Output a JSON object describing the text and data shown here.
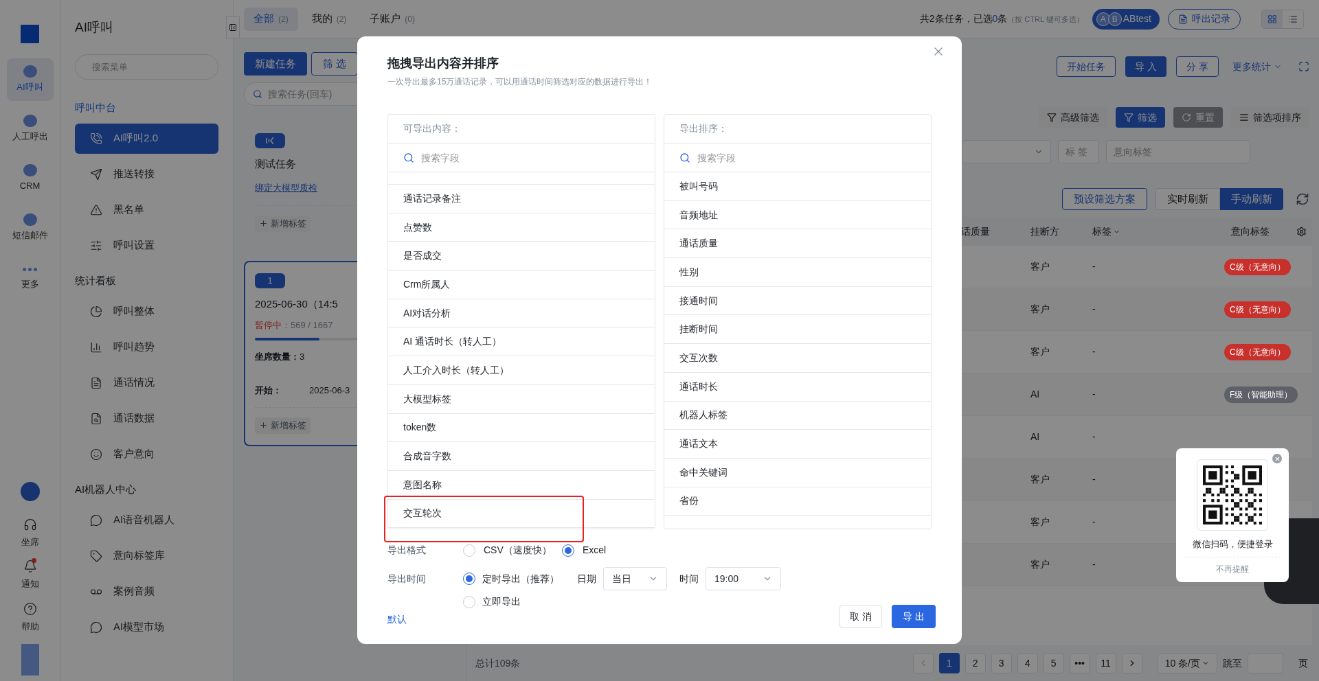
{
  "rail": {
    "items": [
      {
        "label": "AI呼叫",
        "selected": true
      },
      {
        "label": "人工呼出",
        "selected": false
      },
      {
        "label": "CRM",
        "selected": false
      },
      {
        "label": "短信邮件",
        "selected": false
      },
      {
        "label": "更多",
        "selected": false
      }
    ],
    "bottom": [
      {
        "label": "坐席",
        "badge": false
      },
      {
        "label": "通知",
        "badge": true
      },
      {
        "label": "帮助",
        "badge": false
      }
    ]
  },
  "menu": {
    "title": "AI呼叫",
    "search_placeholder": "搜索菜单",
    "sections": [
      {
        "title": "呼叫中台",
        "active": true,
        "items": [
          {
            "label": "AI呼叫2.0",
            "selected": true
          },
          {
            "label": "推送转接",
            "selected": false
          },
          {
            "label": "黑名单",
            "selected": false
          },
          {
            "label": "呼叫设置",
            "selected": false
          }
        ]
      },
      {
        "title": "统计看板",
        "active": false,
        "items": [
          {
            "label": "呼叫整体",
            "selected": false
          },
          {
            "label": "呼叫趋势",
            "selected": false
          },
          {
            "label": "通话情况",
            "selected": false
          },
          {
            "label": "通话数据",
            "selected": false
          },
          {
            "label": "客户意向",
            "selected": false
          }
        ]
      },
      {
        "title": "AI机器人中心",
        "active": false,
        "items": [
          {
            "label": "AI语音机器人",
            "selected": false
          },
          {
            "label": "意向标签库",
            "selected": false
          },
          {
            "label": "案例音频",
            "selected": false
          },
          {
            "label": "AI模型市场",
            "selected": false
          }
        ]
      }
    ]
  },
  "tabs": [
    {
      "label": "全部",
      "count": "(2)",
      "selected": true
    },
    {
      "label": "我的",
      "count": "(2)",
      "selected": false
    },
    {
      "label": "子账户",
      "count": "(0)",
      "selected": false
    }
  ],
  "summary": {
    "text": "共2条任务，已选",
    "count": "0",
    "suffix": "条",
    "hint": "（按 CTRL 键可多选）"
  },
  "ab_button": {
    "avatars": [
      "A",
      "B"
    ],
    "label": "ABtest"
  },
  "call_log_button": "呼出记录",
  "view_modes": [
    {
      "kind": "grid",
      "selected": true
    },
    {
      "kind": "list",
      "selected": false
    }
  ],
  "task_panel": {
    "buttons": [
      "新建任务",
      "筛 选"
    ],
    "search_placeholder": "搜索任务(回车)",
    "cards": [
      {
        "selected": false,
        "title": "测试任务",
        "link": "绑定大模型质检",
        "add_tag": "新增标签"
      },
      {
        "selected": true,
        "badge": "1",
        "title": "2025-06-30（14:5",
        "status": "暂停中",
        "progress": "：569 / 1667",
        "level": 0.34,
        "seats_label": "坐席数量：",
        "seats": "3",
        "start_label": "开始：",
        "start": "2025-06-3",
        "add_tag": "新增标签"
      }
    ]
  },
  "toolbar": {
    "buttons": [
      "开始任务",
      "导 入",
      "分 享"
    ],
    "more": "更多统计"
  },
  "filter_buttons": [
    {
      "label": "高级筛选",
      "kind": "outline"
    },
    {
      "label": "筛选",
      "kind": "primary"
    },
    {
      "label": "重置",
      "kind": "dark"
    },
    {
      "label": "筛选项排序",
      "kind": "outline"
    }
  ],
  "filter_fields": [
    {
      "placeholder": "标 签"
    },
    {
      "placeholder": "意向标签"
    }
  ],
  "preset_button": "预设筛选方案",
  "refresh_modes": [
    {
      "label": "实时刷新",
      "selected": false
    },
    {
      "label": "手动刷新",
      "selected": true
    }
  ],
  "table": {
    "columns": [
      "话质量",
      "挂断方",
      "标签",
      "意向标签"
    ],
    "rows": [
      {
        "hangup": "客户",
        "tag": "-",
        "intent": "C级（无意向）",
        "color": "#c8302c"
      },
      {
        "hangup": "客户",
        "tag": "-",
        "intent": "C级（无意向）",
        "color": "#c8302c"
      },
      {
        "hangup": "客户",
        "tag": "-",
        "intent": "C级（无意向）",
        "color": "#c8302c"
      },
      {
        "hangup": "AI",
        "tag": "-",
        "intent": "F级（智能助理）",
        "color": "#5d6068"
      },
      {
        "hangup": "AI",
        "tag": "-"
      },
      {
        "hangup": "客户",
        "tag": "-"
      },
      {
        "hangup": "客户",
        "tag": "-"
      },
      {
        "hangup": "客户",
        "tag": "-"
      }
    ]
  },
  "pagination": {
    "total": "总计109条",
    "pages": [
      {
        "label": "1",
        "selected": true
      },
      {
        "label": "2",
        "selected": false
      },
      {
        "label": "3",
        "selected": false
      },
      {
        "label": "4",
        "selected": false
      },
      {
        "label": "5",
        "selected": false
      },
      {
        "label": "•••",
        "selected": false
      },
      {
        "label": "11",
        "selected": false
      }
    ],
    "page_size": "10 条/页",
    "jump_label": "跳至",
    "page_suffix": "页"
  },
  "modal": {
    "title": "拖拽导出内容并排序",
    "subtitle": "一次导出最多15万通话记录，可以用通话时间筛选对应的数据进行导出！",
    "available": {
      "header": "可导出内容：",
      "search_placeholder": "搜索字段",
      "items": [
        "通话记录备注",
        "点赞数",
        "是否成交",
        "Crm所属人",
        "AI对话分析",
        "AI 通话时长（转人工）",
        "人工介入时长（转人工）",
        "大模型标签",
        "token数",
        "合成音字数",
        "意图名称",
        "交互轮次"
      ]
    },
    "order": {
      "header": "导出排序：",
      "search_placeholder": "搜索字段",
      "items": [
        "被叫号码",
        "音频地址",
        "通话质量",
        "性别",
        "接通时间",
        "挂断时间",
        "交互次数",
        "通话时长",
        "机器人标签",
        "通话文本",
        "命中关键词",
        "省份"
      ]
    },
    "format": {
      "label": "导出格式",
      "options": [
        {
          "label": "CSV（速度快）",
          "selected": false
        },
        {
          "label": "Excel",
          "selected": true
        }
      ]
    },
    "time": {
      "label": "导出时间",
      "options": [
        {
          "label": "定时导出（推荐）",
          "selected": true
        },
        {
          "label": "立即导出",
          "selected": false
        }
      ],
      "date_label": "日期",
      "date": "当日",
      "time_label": "时间",
      "time": "19:00"
    },
    "default_link": "默认",
    "cancel": "取 消",
    "export": "导 出"
  },
  "qr_popup": {
    "text": "微信扫码，便捷登录",
    "dismiss": "不再提醒"
  }
}
